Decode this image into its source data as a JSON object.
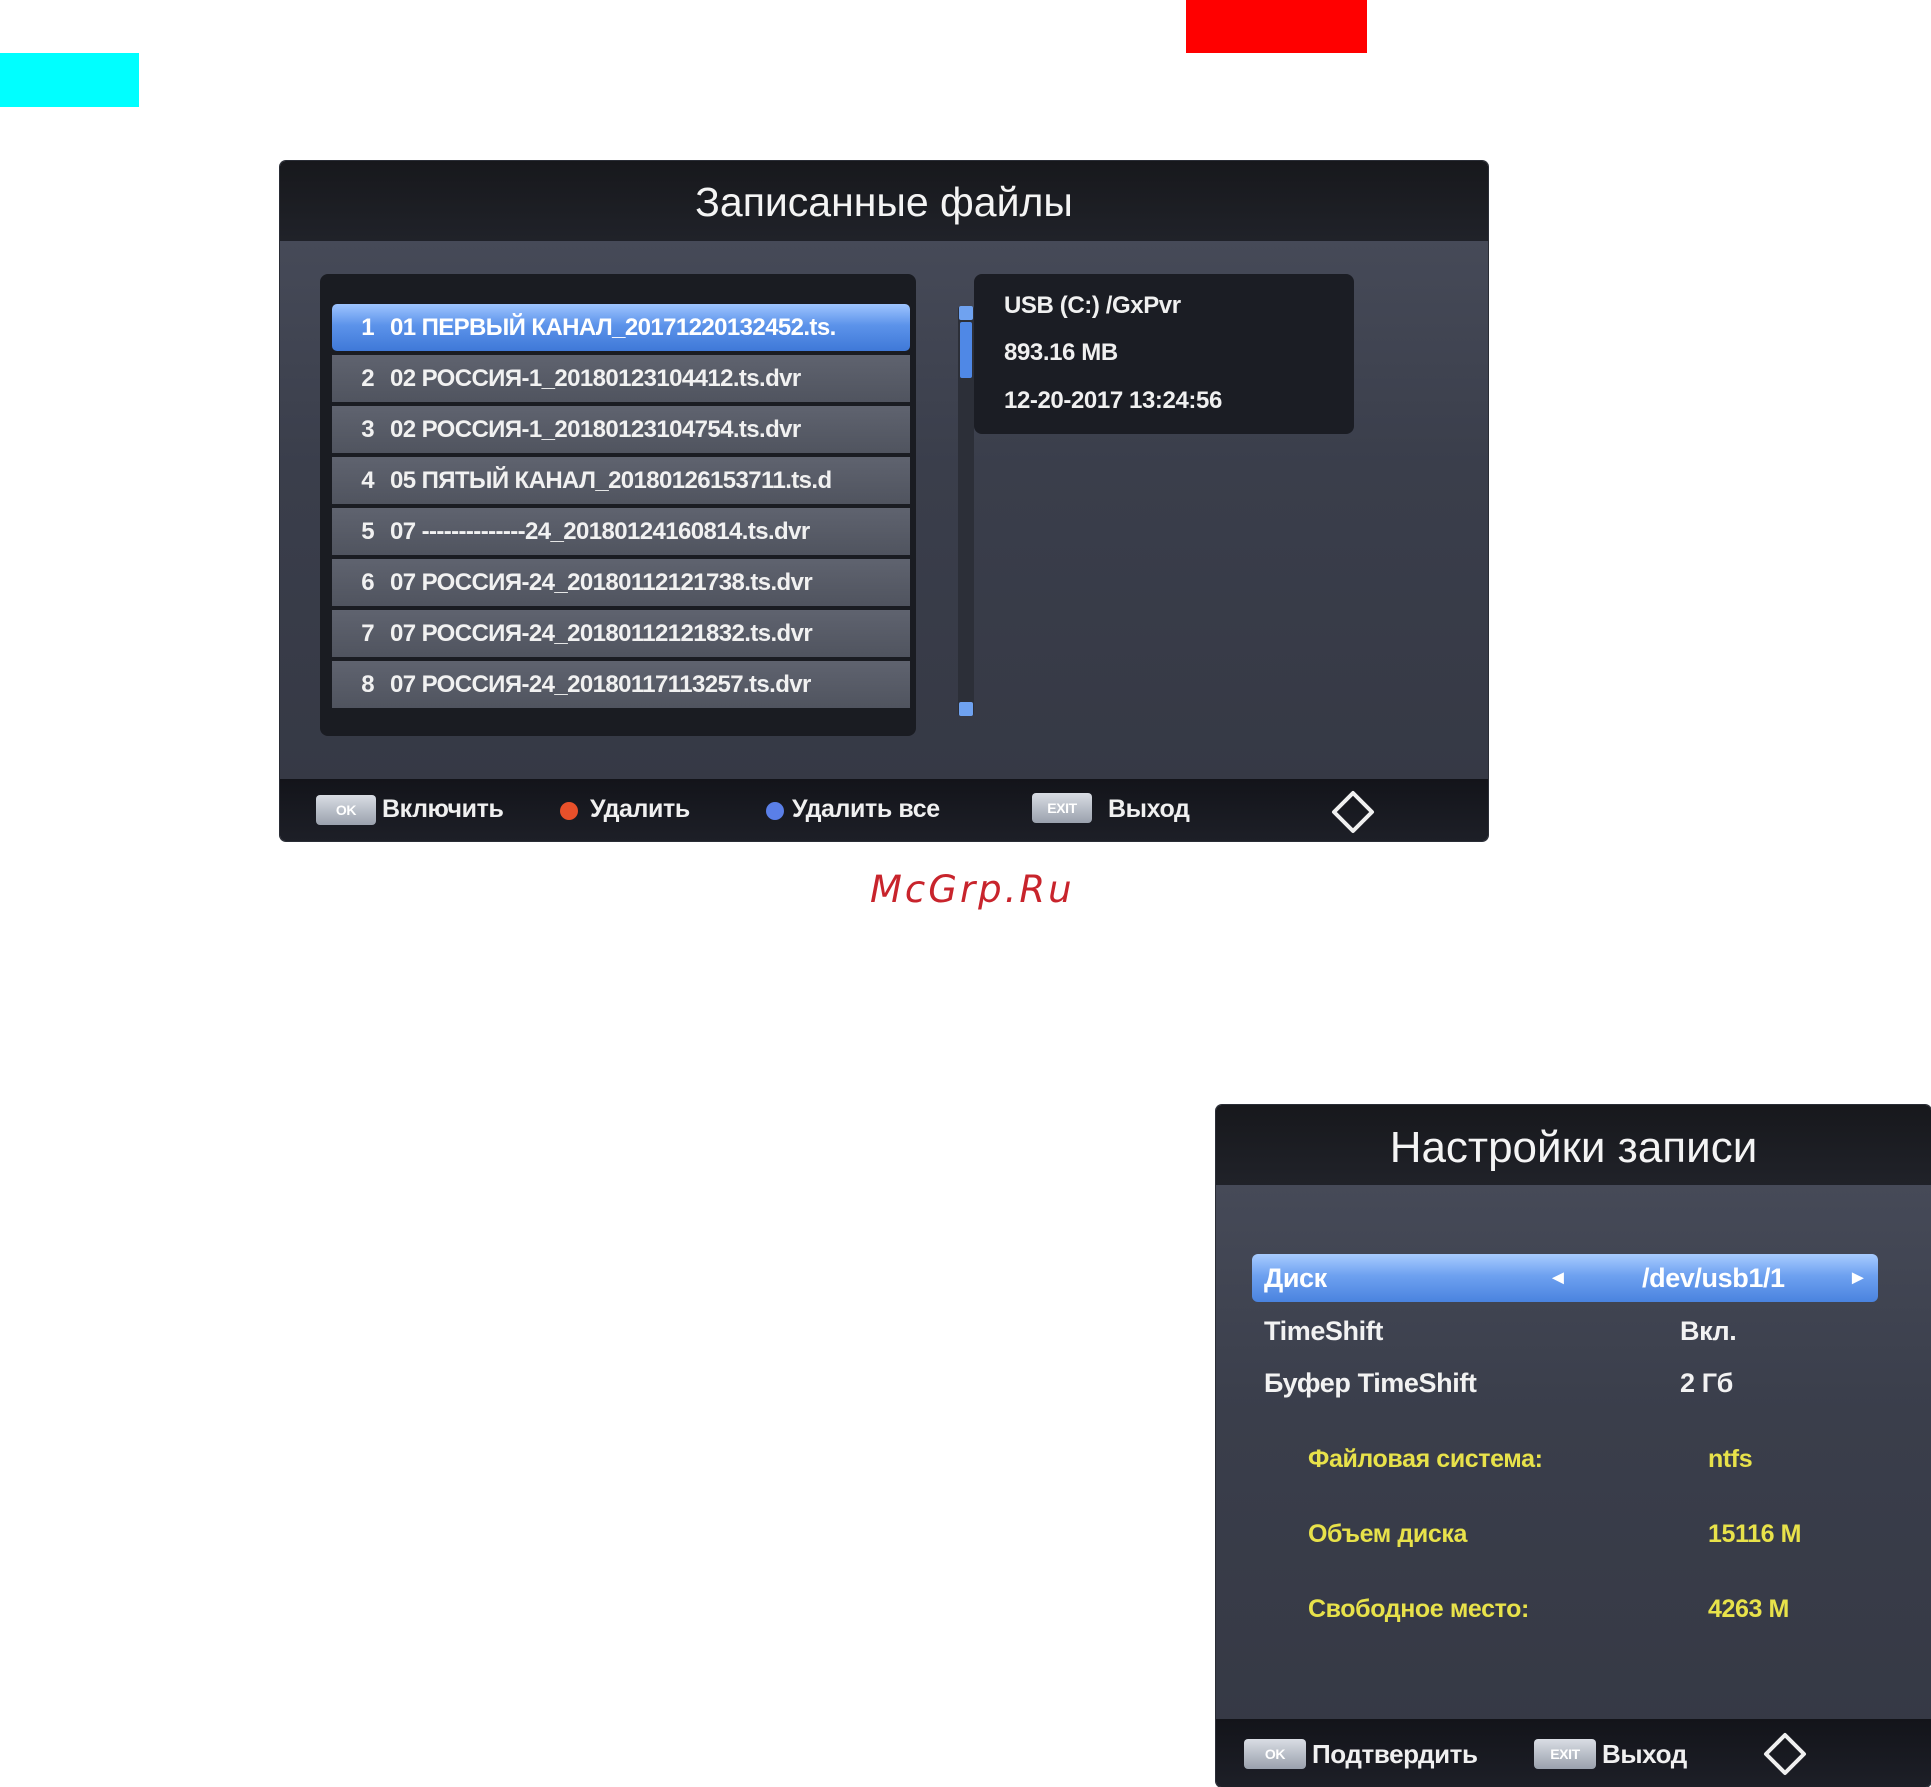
{
  "colors": {
    "cyan_swatch": "#00ffff",
    "red_swatch": "#ff0000",
    "selection_blue": "#4f88e6",
    "disk_info_yellow": "#e8e24a",
    "watermark_red": "#c8242c",
    "red_button_dot": "#e8502a",
    "blue_button_dot": "#5a7fe8"
  },
  "recorded_files": {
    "title": "Записанные файлы",
    "files": [
      {
        "num": "1",
        "name": "01 ПЕРВЫЙ КАНАЛ_20171220132452.ts.",
        "selected": true
      },
      {
        "num": "2",
        "name": "02 РОССИЯ-1_20180123104412.ts.dvr",
        "selected": false
      },
      {
        "num": "3",
        "name": "02 РОССИЯ-1_20180123104754.ts.dvr",
        "selected": false
      },
      {
        "num": "4",
        "name": "05 ПЯТЫЙ КАНАЛ_20180126153711.ts.d",
        "selected": false
      },
      {
        "num": "5",
        "name": "07 --------------24_20180124160814.ts.dvr",
        "selected": false
      },
      {
        "num": "6",
        "name": "07 РОССИЯ-24_20180112121738.ts.dvr",
        "selected": false
      },
      {
        "num": "7",
        "name": "07 РОССИЯ-24_20180112121832.ts.dvr",
        "selected": false
      },
      {
        "num": "8",
        "name": "07 РОССИЯ-24_20180117113257.ts.dvr",
        "selected": false
      }
    ],
    "info": {
      "path": "USB (C:) /GxPvr",
      "size": "893.16 MB",
      "date": "12-20-2017 13:24:56"
    },
    "footer": {
      "ok_key": "OK",
      "play_label": "Включить",
      "delete_label": "Удалить",
      "delete_all_label": "Удалить все",
      "exit_key": "EXIT",
      "exit_label": "Выход"
    }
  },
  "watermark": "McGrp.Ru",
  "record_settings": {
    "title": "Настройки записи",
    "rows": [
      {
        "label": "Диск",
        "value": "/dev/usb1/1",
        "selected": true
      },
      {
        "label": "TimeShift",
        "value": "Вкл.",
        "selected": false
      },
      {
        "label": "Буфер TimeShift",
        "value": "2 Гб",
        "selected": false
      }
    ],
    "disk_info": [
      {
        "label": "Файловая система:",
        "value": "ntfs"
      },
      {
        "label": "Объем диска",
        "value": "15116 M"
      },
      {
        "label": "Свободное место:",
        "value": "4263 M"
      }
    ],
    "footer": {
      "ok_key": "OK",
      "confirm_label": "Подтвердить",
      "exit_key": "EXIT",
      "exit_label": "Выход"
    }
  }
}
